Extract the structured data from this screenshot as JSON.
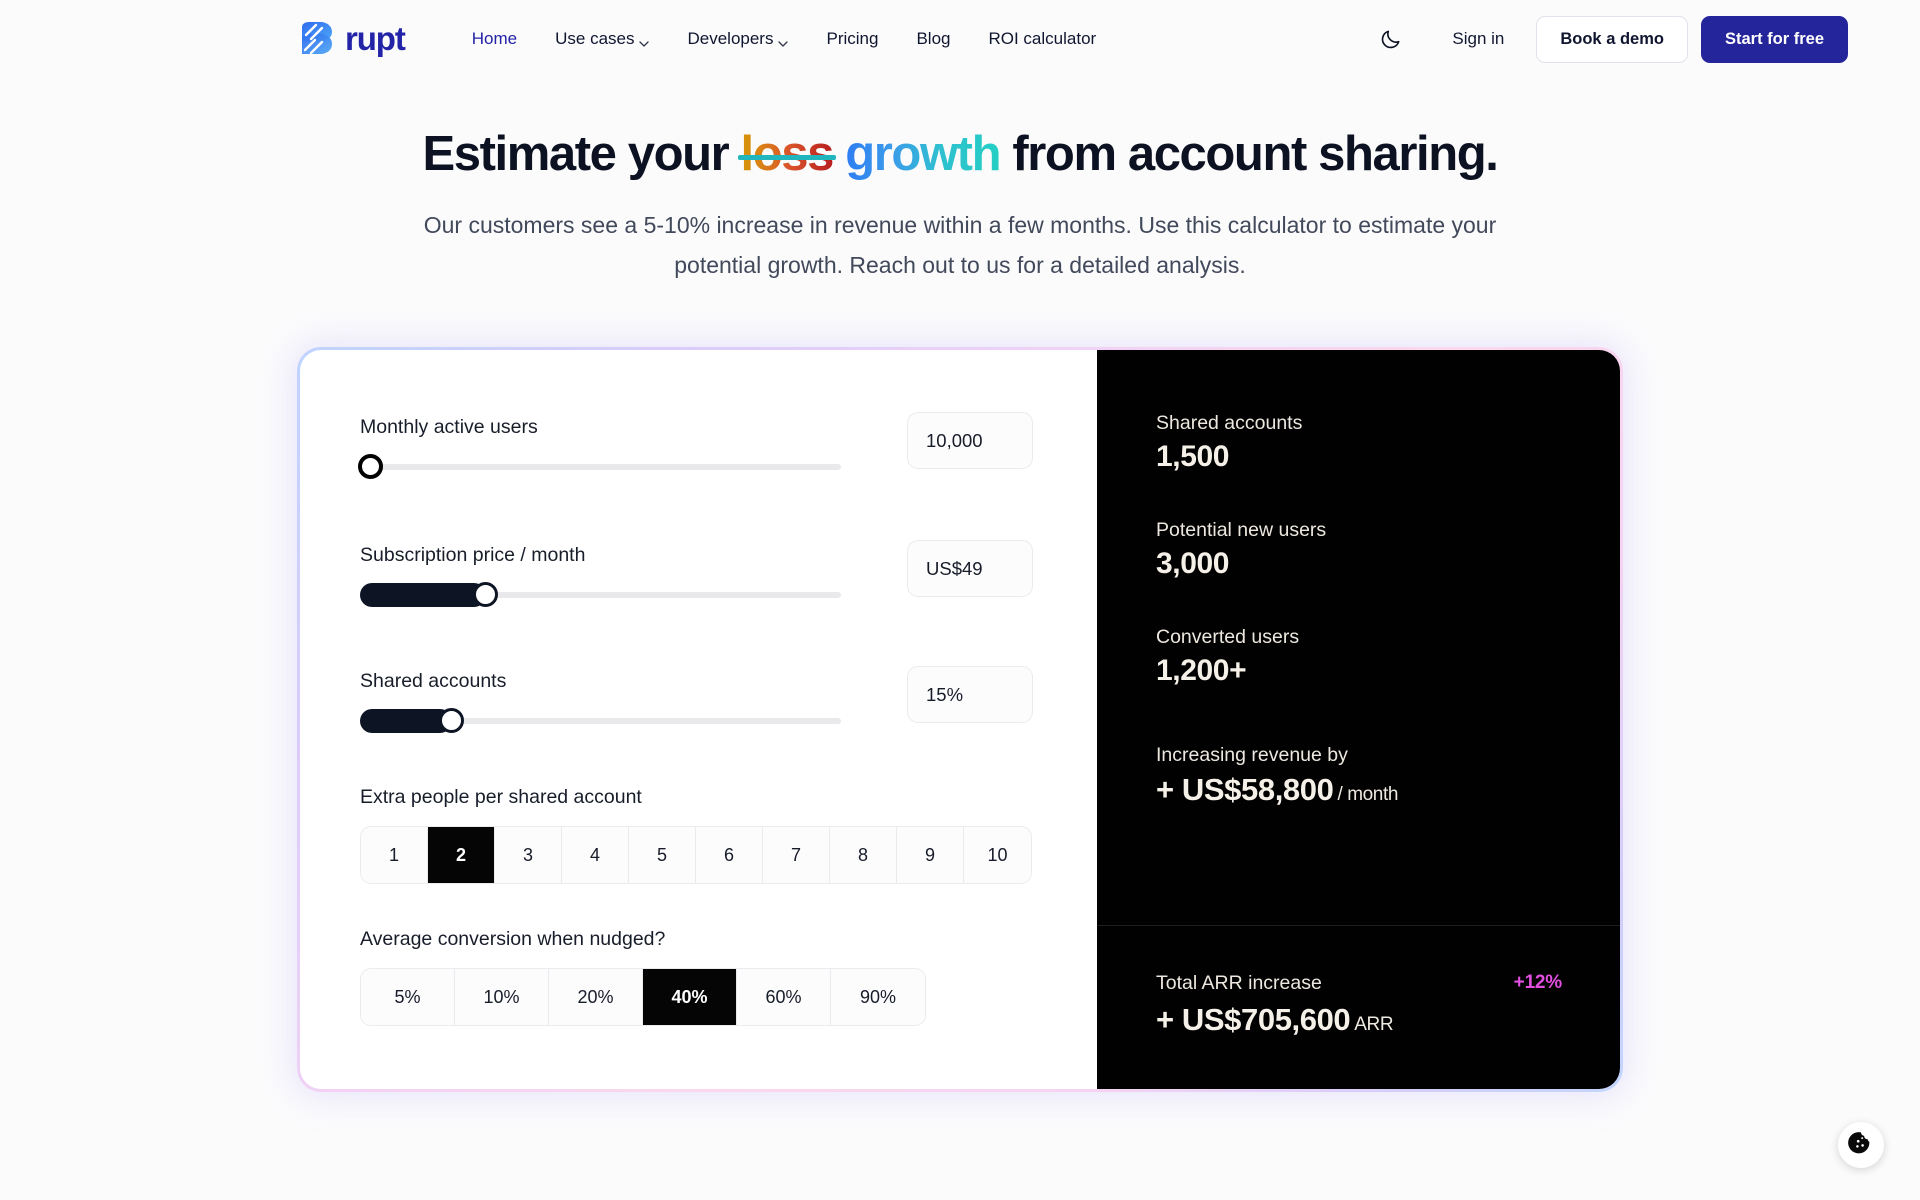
{
  "nav": {
    "brand": "rupt",
    "links": [
      {
        "label": "Home",
        "icon": null,
        "active": true
      },
      {
        "label": "Use cases",
        "icon": "chevron-down-icon",
        "active": false
      },
      {
        "label": "Developers",
        "icon": "chevron-down-icon",
        "active": false
      },
      {
        "label": "Pricing",
        "icon": null,
        "active": false
      },
      {
        "label": "Blog",
        "icon": null,
        "active": false
      },
      {
        "label": "ROI calculator",
        "icon": null,
        "active": false
      }
    ],
    "theme_toggle_icon": "moon-icon",
    "sign_in": "Sign in",
    "book_demo": "Book a demo",
    "start_free": "Start for free",
    "brand_color": "#2323A8",
    "primary_button_color": "#25259B"
  },
  "hero": {
    "headline_part1": "Estimate your",
    "headline_strike": "loss",
    "headline_highlight": "growth",
    "headline_part2": "from account sharing.",
    "subhead": "Our customers see a 5-10% increase in revenue within a few months. Use this calculator to estimate your potential growth. Reach out to us for a detailed analysis.",
    "strike_color": "#21B6BE",
    "loss_gradient": [
      "#D59407",
      "#B81E1E"
    ],
    "growth_gradient": [
      "#2E7DF2",
      "#24CFC4"
    ]
  },
  "calculator": {
    "sliders": [
      {
        "label": "Monthly active users",
        "value": "10,000",
        "fill_percent": 0,
        "thumb_style": "hollow"
      },
      {
        "label": "Subscription price / month",
        "value": "US$49",
        "fill_percent": 21,
        "thumb_style": "solid"
      },
      {
        "label": "Shared accounts",
        "value": "15%",
        "fill_percent": 15,
        "thumb_style": "solid"
      }
    ],
    "segments": [
      {
        "label": "Extra people per shared account",
        "options": [
          "1",
          "2",
          "3",
          "4",
          "5",
          "6",
          "7",
          "8",
          "9",
          "10"
        ],
        "selected": "2",
        "wide": false
      },
      {
        "label": "Average conversion when nudged?",
        "options": [
          "5%",
          "10%",
          "20%",
          "40%",
          "60%",
          "90%"
        ],
        "selected": "40%",
        "wide": true
      }
    ]
  },
  "results": {
    "items": [
      {
        "label": "Shared accounts",
        "value": "1,500",
        "unit": ""
      },
      {
        "label": "Potential new users",
        "value": "3,000",
        "unit": ""
      },
      {
        "label": "Converted users",
        "value": "1,200+",
        "unit": ""
      },
      {
        "label": "Increasing revenue by",
        "value": "+ US$58,800",
        "unit": "/ month"
      }
    ],
    "footer": {
      "label": "Total ARR increase",
      "badge": "+12%",
      "badge_color": "#E14FE0",
      "value": "+ US$705,600",
      "unit": "ARR"
    },
    "panel_bg": "#010101",
    "text_color": "#F4EFE6"
  },
  "cookie_widget": {
    "icon": "cookie-icon"
  }
}
